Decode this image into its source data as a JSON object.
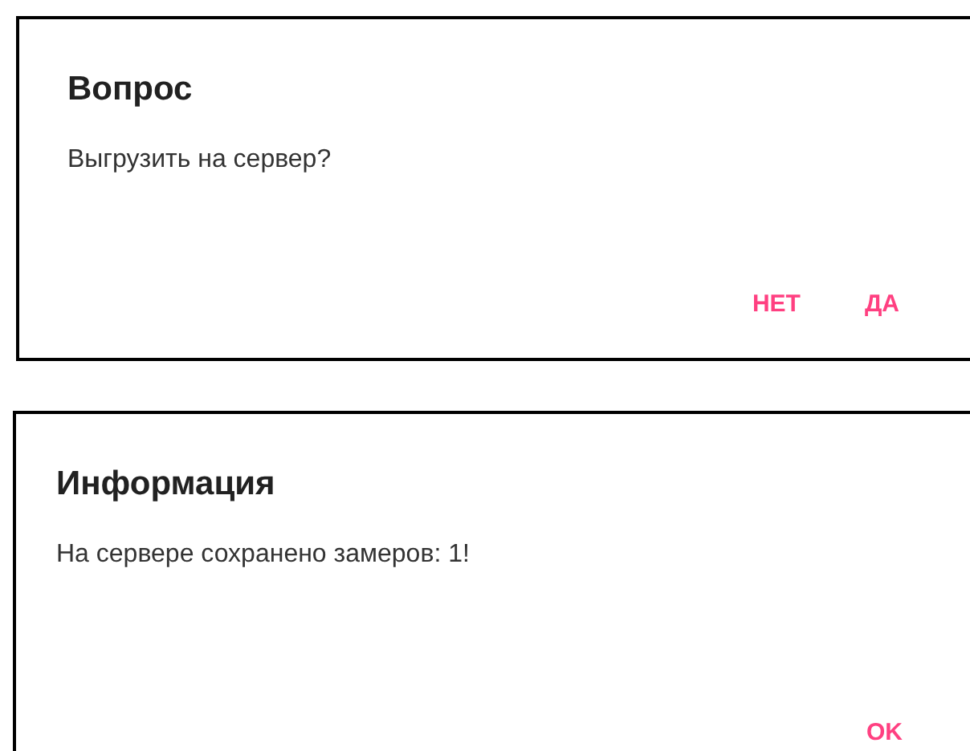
{
  "dialogs": [
    {
      "title": "Вопрос",
      "message": "Выгрузить на сервер?",
      "buttons": [
        "НЕТ",
        "ДА"
      ]
    },
    {
      "title": "Информация",
      "message": "На сервере сохранено замеров: 1!",
      "buttons": [
        "OK"
      ]
    }
  ]
}
